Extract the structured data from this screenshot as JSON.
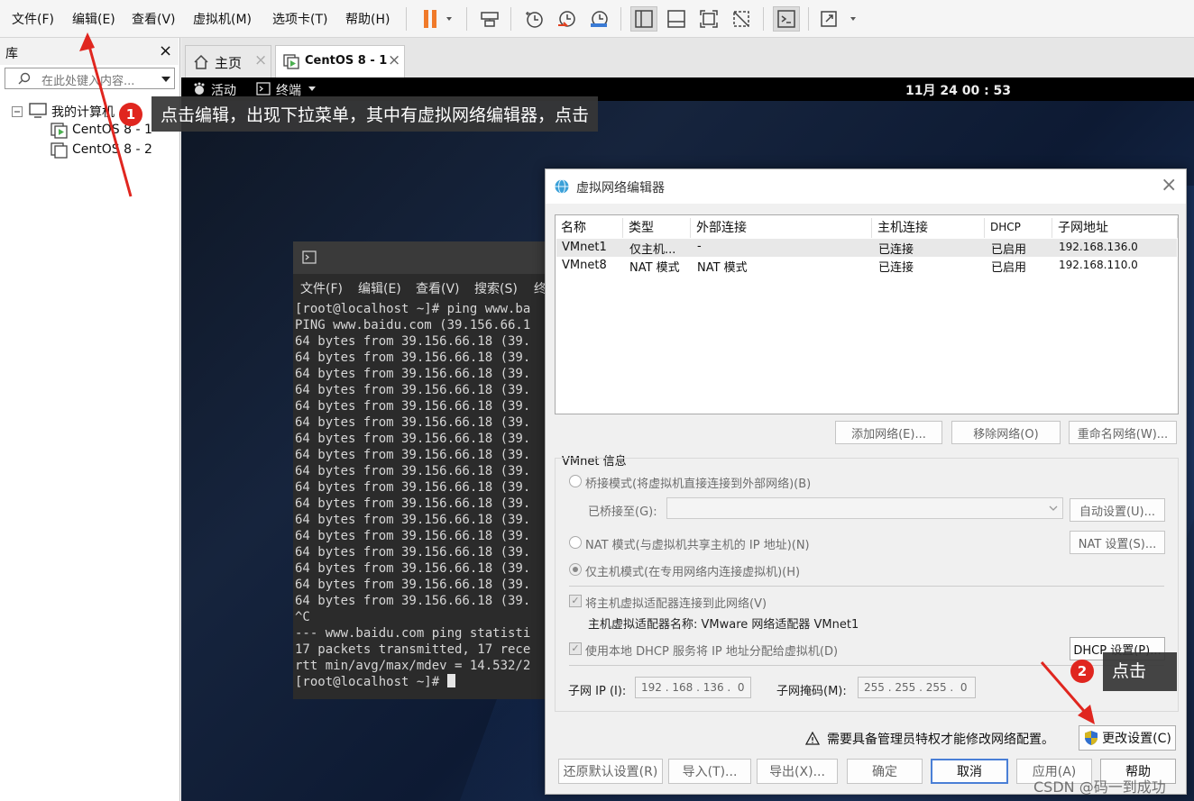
{
  "menubar": {
    "items": [
      "文件(F)",
      "编辑(E)",
      "查看(V)",
      "虚拟机(M)",
      "选项卡(T)",
      "帮助(H)"
    ]
  },
  "library": {
    "title": "库",
    "close": "×",
    "search_placeholder": "在此处键入内容...",
    "root": "我的计算机",
    "vms": [
      "CentOS 8 - 1",
      "CentOS 8 - 2"
    ]
  },
  "tabs": {
    "home": "主页",
    "vm": "CentOS 8 - 1",
    "close": "×"
  },
  "gnome": {
    "activities": "活动",
    "terminal": "终端",
    "clock": "11月 24 00 : 53"
  },
  "terminal": {
    "menu": [
      "文件(F)",
      "编辑(E)",
      "查看(V)",
      "搜索(S)",
      "终"
    ],
    "lines": [
      "[root@localhost ~]# ping www.ba",
      "PING www.baidu.com (39.156.66.1",
      "64 bytes from 39.156.66.18 (39.",
      "64 bytes from 39.156.66.18 (39.",
      "64 bytes from 39.156.66.18 (39.",
      "64 bytes from 39.156.66.18 (39.",
      "64 bytes from 39.156.66.18 (39.",
      "64 bytes from 39.156.66.18 (39.",
      "64 bytes from 39.156.66.18 (39.",
      "64 bytes from 39.156.66.18 (39.",
      "64 bytes from 39.156.66.18 (39.",
      "64 bytes from 39.156.66.18 (39.",
      "64 bytes from 39.156.66.18 (39.",
      "64 bytes from 39.156.66.18 (39.",
      "64 bytes from 39.156.66.18 (39.",
      "64 bytes from 39.156.66.18 (39.",
      "64 bytes from 39.156.66.18 (39.",
      "64 bytes from 39.156.66.18 (39.",
      "64 bytes from 39.156.66.18 (39.",
      "^C",
      "--- www.baidu.com ping statisti",
      "17 packets transmitted, 17 rece",
      "rtt min/avg/max/mdev = 14.532/2",
      "[root@localhost ~]# "
    ]
  },
  "dialog": {
    "title": "虚拟网络编辑器",
    "close": "×",
    "columns": [
      "名称",
      "类型",
      "外部连接",
      "主机连接",
      "DHCP",
      "子网地址"
    ],
    "rows": [
      [
        "VMnet1",
        "仅主机...",
        "-",
        "已连接",
        "已启用",
        "192.168.136.0"
      ],
      [
        "VMnet8",
        "NAT 模式",
        "NAT 模式",
        "已连接",
        "已启用",
        "192.168.110.0"
      ]
    ],
    "add_network": "添加网络(E)...",
    "remove_network": "移除网络(O)",
    "rename_network": "重命名网络(W)...",
    "vmnet_info": "VMnet 信息",
    "bridged_mode": "桥接模式(将虚拟机直接连接到外部网络)(B)",
    "bridged_to": "已桥接至(G):",
    "auto_settings": "自动设置(U)...",
    "nat_mode": "NAT 模式(与虚拟机共享主机的 IP 地址)(N)",
    "nat_settings": "NAT 设置(S)...",
    "host_only_mode": "仅主机模式(在专用网络内连接虚拟机)(H)",
    "connect_adapter": "将主机虚拟适配器连接到此网络(V)",
    "adapter_name": "主机虚拟适配器名称: VMware 网络适配器 VMnet1",
    "use_dhcp": "使用本地 DHCP 服务将 IP 地址分配给虚拟机(D)",
    "dhcp_settings": "DHCP 设置(P)...",
    "subnet_ip_label": "子网 IP (I):",
    "subnet_ip": "192 . 168 . 136 .  0",
    "subnet_mask_label": "子网掩码(M):",
    "subnet_mask": "255 . 255 . 255 .  0",
    "admin_warning": "需要具备管理员特权才能修改网络配置。",
    "change_settings": "更改设置(C)",
    "restore_defaults": "还原默认设置(R)",
    "import": "导入(T)...",
    "export": "导出(X)...",
    "ok": "确定",
    "cancel": "取消",
    "apply": "应用(A)",
    "help": "帮助"
  },
  "annotations": {
    "badge1": "1",
    "note1": "点击编辑，出现下拉菜单，其中有虚拟网络编辑器，点击",
    "badge2": "2",
    "note2": "点击"
  },
  "watermark": "CSDN @码一到成功",
  "colors": {
    "annotation_red": "#e0261f",
    "pause_orange": "#f07a2a",
    "vm_play_green": "#4caf50"
  }
}
